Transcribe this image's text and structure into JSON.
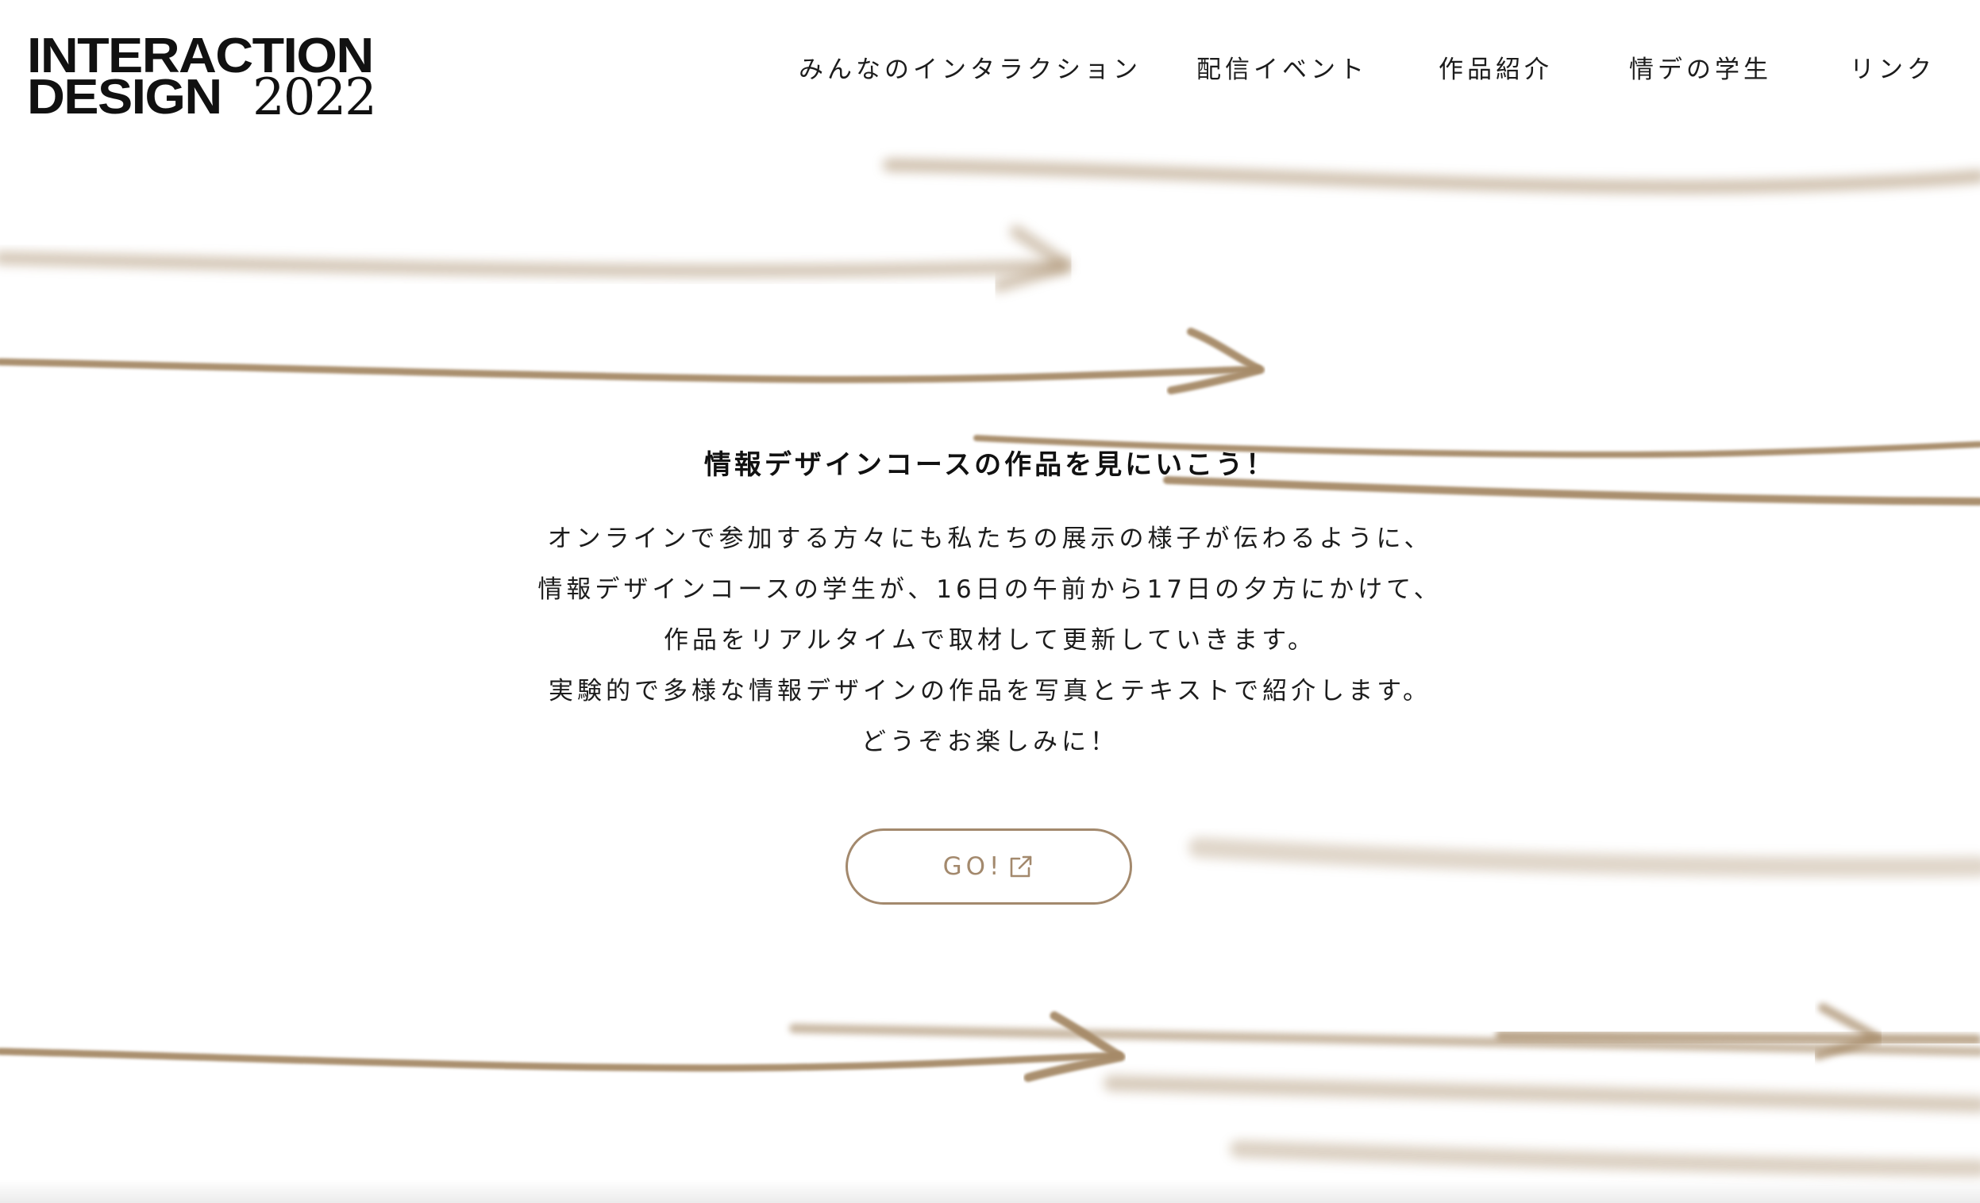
{
  "logo": {
    "line1": "INTERACTION",
    "line2_word": "DESIGN",
    "line2_year": "2022"
  },
  "nav": {
    "items": [
      {
        "label": "みんなのインタラクション"
      },
      {
        "label": "配信イベント"
      },
      {
        "label": "作品紹介"
      },
      {
        "label": "情デの学生"
      },
      {
        "label": "リンク"
      }
    ]
  },
  "main": {
    "headline": "情報デザインコースの作品を見にいこう！",
    "body_lines": [
      "オンラインで参加する方々にも私たちの展示の様子が伝わるように、",
      "情報デザインコースの学生が、16日の午前から17日の夕方にかけて、",
      "作品をリアルタイムで取材して更新していきます。",
      "実験的で多様な情報デザインの作品を写真とテキストで紹介します。",
      "どうぞお楽しみに！"
    ],
    "go_button": {
      "label": "GO!",
      "icon": "external-link-icon"
    }
  },
  "colors": {
    "accent": "#a3896d",
    "arrow": "#a68a68",
    "text": "#1c1c1c",
    "background": "#ffffff"
  }
}
